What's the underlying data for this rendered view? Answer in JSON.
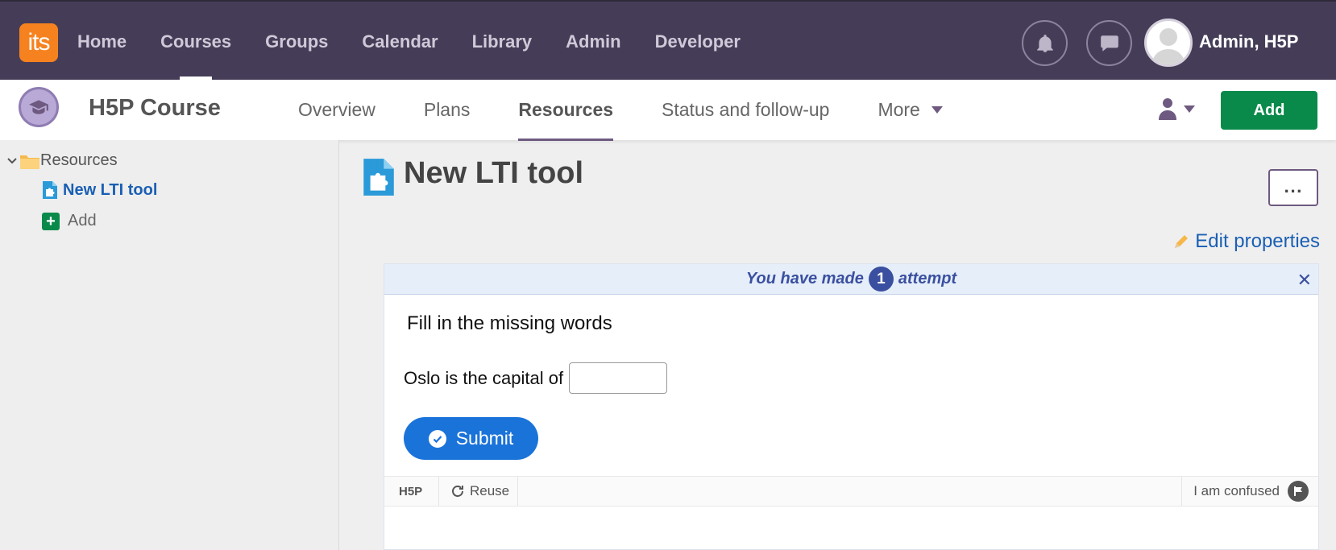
{
  "topbar": {
    "logo_text": "its",
    "nav": [
      "Home",
      "Courses",
      "Groups",
      "Calendar",
      "Library",
      "Admin",
      "Developer"
    ],
    "user_name": "Admin, H5P"
  },
  "course": {
    "title": "H5P Course",
    "tabs": [
      "Overview",
      "Plans",
      "Resources",
      "Status and follow-up",
      "More"
    ],
    "add_label": "Add"
  },
  "sidebar": {
    "root": "Resources",
    "selected_item": "New LTI tool",
    "add_label": "Add"
  },
  "main": {
    "title": "New LTI tool",
    "more_label": "...",
    "edit_properties": "Edit properties"
  },
  "h5p": {
    "attempt_prefix": "You have made",
    "attempt_count": "1",
    "attempt_suffix": "attempt",
    "question": "Fill in the missing words",
    "sentence": "Oslo is the capital of",
    "blank_value": "",
    "submit_label": "Submit",
    "footer_logo": "H5P",
    "reuse_label": "Reuse",
    "confused_label": "I am confused"
  },
  "colors": {
    "topbar": "#453d58",
    "logo": "#f6821f",
    "add_button": "#0a8a4a",
    "link": "#1a5fb4",
    "submit": "#1a73d9"
  }
}
